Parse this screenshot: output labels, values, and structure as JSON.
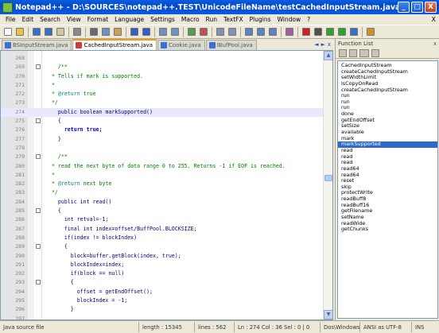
{
  "window": {
    "title": "Notepad++ - D:\\SOURCES\\notepad++.TEST\\UnicodeFileName\\testCachedInputStream.java",
    "controls": [
      "_",
      "□",
      "X"
    ]
  },
  "menubar": {
    "items": [
      "File",
      "Edit",
      "Search",
      "View",
      "Format",
      "Language",
      "Settings",
      "Macro",
      "Run",
      "TextFX",
      "Plugins",
      "Window",
      "?"
    ],
    "close": "X"
  },
  "toolbar": {
    "icons": [
      {
        "name": "new-file-icon",
        "color": "#ffffff"
      },
      {
        "name": "open-file-icon",
        "color": "#e8c04a"
      },
      {
        "name": "save-icon",
        "color": "#3c6ec8"
      },
      {
        "name": "save-all-icon",
        "color": "#3c6ec8"
      },
      {
        "name": "close-icon",
        "color": "#d0c8a0"
      },
      {
        "name": "print-icon",
        "color": "#8a8a8a"
      },
      {
        "name": "cut-icon",
        "color": "#6a6a6a"
      },
      {
        "name": "copy-icon",
        "color": "#6f8fc0"
      },
      {
        "name": "paste-icon",
        "color": "#c8a060"
      },
      {
        "name": "undo-icon",
        "color": "#3060c0"
      },
      {
        "name": "redo-icon",
        "color": "#3060c0"
      },
      {
        "name": "find-icon",
        "color": "#7090c0"
      },
      {
        "name": "replace-icon",
        "color": "#7090c0"
      },
      {
        "name": "zoom-in-icon",
        "color": "#50a050"
      },
      {
        "name": "zoom-out-icon",
        "color": "#c05050"
      },
      {
        "name": "sync-v-icon",
        "color": "#8090b0"
      },
      {
        "name": "sync-h-icon",
        "color": "#8090b0"
      },
      {
        "name": "wrap-icon",
        "color": "#6080c0"
      },
      {
        "name": "show-all-icon",
        "color": "#6080c0"
      },
      {
        "name": "indent-guide-icon",
        "color": "#6080c0"
      },
      {
        "name": "udl-icon",
        "color": "#a060a0"
      },
      {
        "name": "record-macro-icon",
        "color": "#d02020"
      },
      {
        "name": "stop-macro-icon",
        "color": "#505050"
      },
      {
        "name": "play-macro-icon",
        "color": "#30a030"
      },
      {
        "name": "play-multiple-icon",
        "color": "#30a030"
      },
      {
        "name": "save-macro-icon",
        "color": "#3c6ec8"
      },
      {
        "name": "function-list-icon",
        "color": "#d09030"
      }
    ]
  },
  "tabs": [
    {
      "label": "BSInputStream.java",
      "active": false
    },
    {
      "label": "CachedInputStream.java",
      "active": true
    },
    {
      "label": "Cookie.java",
      "active": false
    },
    {
      "label": "IBufPool.java",
      "active": false
    }
  ],
  "tab_arrows": [
    "◄",
    "►",
    "x"
  ],
  "editor": {
    "lines": [
      {
        "num": "268",
        "fold": false,
        "hl": false,
        "segs": [
          {
            "t": "",
            "c": "c-plain"
          }
        ]
      },
      {
        "num": "269",
        "fold": true,
        "hl": false,
        "segs": [
          {
            "t": "    /**",
            "c": "c-com"
          }
        ]
      },
      {
        "num": "270",
        "fold": false,
        "hl": false,
        "segs": [
          {
            "t": "  * Tells if mark is supported.",
            "c": "c-com"
          }
        ]
      },
      {
        "num": "271",
        "fold": false,
        "hl": false,
        "segs": [
          {
            "t": "  *",
            "c": "c-com"
          }
        ]
      },
      {
        "num": "272",
        "fold": false,
        "hl": false,
        "segs": [
          {
            "t": "  * ",
            "c": "c-com"
          },
          {
            "t": "@return",
            "c": "c-doc"
          },
          {
            "t": " true",
            "c": "c-com"
          }
        ]
      },
      {
        "num": "273",
        "fold": false,
        "hl": false,
        "segs": [
          {
            "t": "  */",
            "c": "c-com"
          }
        ]
      },
      {
        "num": "274",
        "fold": false,
        "hl": true,
        "segs": [
          {
            "t": "    public boolean markSupported()",
            "c": "c-plain"
          }
        ]
      },
      {
        "num": "275",
        "fold": true,
        "hl": false,
        "segs": [
          {
            "t": "    {",
            "c": "c-plain"
          }
        ]
      },
      {
        "num": "276",
        "fold": false,
        "hl": false,
        "segs": [
          {
            "t": "      ",
            "c": "c-plain"
          },
          {
            "t": "return true;",
            "c": "c-kw"
          }
        ]
      },
      {
        "num": "277",
        "fold": false,
        "hl": false,
        "segs": [
          {
            "t": "    }",
            "c": "c-plain"
          }
        ]
      },
      {
        "num": "278",
        "fold": false,
        "hl": false,
        "segs": [
          {
            "t": "",
            "c": "c-plain"
          }
        ]
      },
      {
        "num": "279",
        "fold": true,
        "hl": false,
        "segs": [
          {
            "t": "    /**",
            "c": "c-com"
          }
        ]
      },
      {
        "num": "280",
        "fold": false,
        "hl": false,
        "segs": [
          {
            "t": "  * read the next byte of data range 0 to 255. Returns -1 if EOF is reached.",
            "c": "c-com"
          }
        ]
      },
      {
        "num": "281",
        "fold": false,
        "hl": false,
        "segs": [
          {
            "t": "  *",
            "c": "c-com"
          }
        ]
      },
      {
        "num": "282",
        "fold": false,
        "hl": false,
        "segs": [
          {
            "t": "  * ",
            "c": "c-com"
          },
          {
            "t": "@return",
            "c": "c-doc"
          },
          {
            "t": " next byte",
            "c": "c-com"
          }
        ]
      },
      {
        "num": "283",
        "fold": false,
        "hl": false,
        "segs": [
          {
            "t": "  */",
            "c": "c-com"
          }
        ]
      },
      {
        "num": "284",
        "fold": false,
        "hl": false,
        "segs": [
          {
            "t": "    public int read()",
            "c": "c-plain"
          }
        ]
      },
      {
        "num": "285",
        "fold": true,
        "hl": false,
        "segs": [
          {
            "t": "    {",
            "c": "c-plain"
          }
        ]
      },
      {
        "num": "286",
        "fold": false,
        "hl": false,
        "segs": [
          {
            "t": "      int retval=-1;",
            "c": "c-plain"
          }
        ]
      },
      {
        "num": "287",
        "fold": false,
        "hl": false,
        "segs": [
          {
            "t": "      final int index=offset/BuffPool.BLOCKSIZE;",
            "c": "c-plain"
          }
        ]
      },
      {
        "num": "288",
        "fold": false,
        "hl": false,
        "segs": [
          {
            "t": "      if(index != blockIndex)",
            "c": "c-plain"
          }
        ]
      },
      {
        "num": "289",
        "fold": true,
        "hl": false,
        "segs": [
          {
            "t": "      {",
            "c": "c-plain"
          }
        ]
      },
      {
        "num": "290",
        "fold": false,
        "hl": false,
        "segs": [
          {
            "t": "        block=buffer.getBlock(index, true);",
            "c": "c-plain"
          }
        ]
      },
      {
        "num": "291",
        "fold": false,
        "hl": false,
        "segs": [
          {
            "t": "        blockIndex=index;",
            "c": "c-plain"
          }
        ]
      },
      {
        "num": "292",
        "fold": false,
        "hl": false,
        "segs": [
          {
            "t": "        if(block == null)",
            "c": "c-plain"
          }
        ]
      },
      {
        "num": "293",
        "fold": true,
        "hl": false,
        "segs": [
          {
            "t": "        {",
            "c": "c-plain"
          }
        ]
      },
      {
        "num": "294",
        "fold": false,
        "hl": false,
        "segs": [
          {
            "t": "          offset = getEndOffset();",
            "c": "c-plain"
          }
        ]
      },
      {
        "num": "295",
        "fold": false,
        "hl": false,
        "segs": [
          {
            "t": "          blockIndex = -1;",
            "c": "c-plain"
          }
        ]
      },
      {
        "num": "296",
        "fold": false,
        "hl": false,
        "segs": [
          {
            "t": "        }",
            "c": "c-plain"
          }
        ]
      },
      {
        "num": "297",
        "fold": false,
        "hl": false,
        "segs": [
          {
            "t": "",
            "c": "c-plain"
          }
        ]
      }
    ]
  },
  "function_list": {
    "title": "Function List",
    "close": "x",
    "items": [
      "CachedInputStream",
      "createCachedInputStream",
      "setWidthLimit",
      "isCopyOnRead",
      "createCachedInputStream",
      "run",
      "run",
      "run",
      "done",
      "getEndOffset",
      "setSize",
      "available",
      "mark",
      "markSupported",
      "read",
      "read",
      "read",
      "read64",
      "read64",
      "reset",
      "skip",
      "protectWrite",
      "readBuff8",
      "readBuff16",
      "getFilename",
      "setName",
      "readWide",
      "getChunks"
    ],
    "selected_index": 13
  },
  "statusbar": {
    "type": "Java source file",
    "length": "length : 15345",
    "lines": "lines : 562",
    "position": "Ln : 274    Col : 36    Sel : 0 | 0",
    "eol": "Dos\\Windows",
    "encoding": "ANSI as UTF-8",
    "mode": "INS"
  }
}
